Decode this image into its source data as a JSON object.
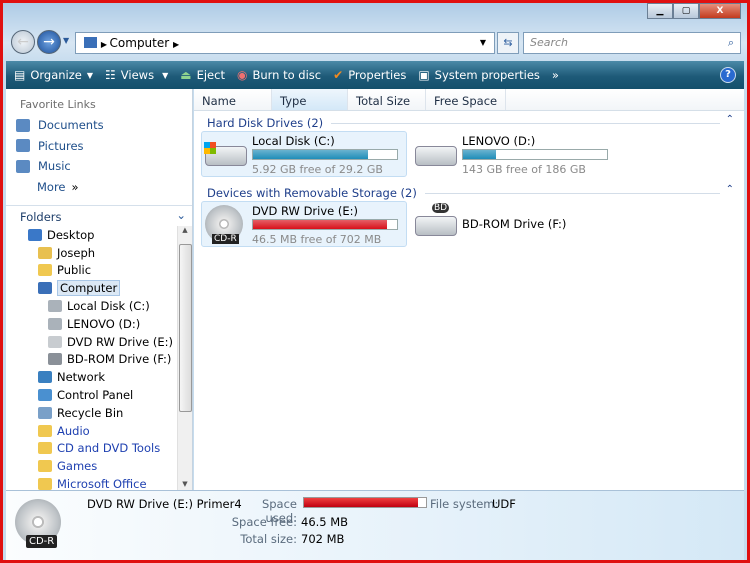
{
  "window": {
    "buttons": [
      "minimize",
      "maximize",
      "close"
    ]
  },
  "nav": {
    "address": [
      "Computer"
    ],
    "search_placeholder": "Search"
  },
  "toolbar": {
    "items": [
      {
        "label": "Organize",
        "icon": "organize-icon",
        "dropdown": true
      },
      {
        "label": "Views",
        "icon": "views-icon",
        "dropdown": true
      },
      {
        "label": "Eject",
        "icon": "eject-icon"
      },
      {
        "label": "Burn to disc",
        "icon": "burn-icon"
      },
      {
        "label": "Properties",
        "icon": "checkmark-icon"
      },
      {
        "label": "System properties",
        "icon": "system-properties-icon"
      }
    ],
    "more": "»",
    "help": "?"
  },
  "favorites": {
    "title": "Favorite Links",
    "items": [
      "Documents",
      "Pictures",
      "Music"
    ],
    "more": "More"
  },
  "folders": {
    "title": "Folders",
    "tree": [
      {
        "label": "Desktop",
        "level": 0,
        "icon": "desktop-icon"
      },
      {
        "label": "Joseph",
        "level": 1,
        "icon": "user-folder-icon"
      },
      {
        "label": "Public",
        "level": 1,
        "icon": "folder-icon"
      },
      {
        "label": "Computer",
        "level": 1,
        "icon": "computer-icon",
        "selected": true
      },
      {
        "label": "Local Disk (C:)",
        "level": 2,
        "icon": "hard-drive-icon"
      },
      {
        "label": "LENOVO (D:)",
        "level": 2,
        "icon": "hard-drive-icon"
      },
      {
        "label": "DVD RW Drive (E:) Primer4",
        "level": 2,
        "icon": "cd-icon"
      },
      {
        "label": "BD-ROM Drive (F:)",
        "level": 2,
        "icon": "bd-drive-icon"
      },
      {
        "label": "Network",
        "level": 1,
        "icon": "network-icon"
      },
      {
        "label": "Control Panel",
        "level": 1,
        "icon": "control-panel-icon"
      },
      {
        "label": "Recycle Bin",
        "level": 1,
        "icon": "recycle-bin-icon"
      },
      {
        "label": "Audio",
        "level": 1,
        "icon": "folder-icon",
        "link": true
      },
      {
        "label": "CD and DVD Tools",
        "level": 1,
        "icon": "folder-icon",
        "link": true
      },
      {
        "label": "Games",
        "level": 1,
        "icon": "folder-icon",
        "link": true
      },
      {
        "label": "Microsoft Office",
        "level": 1,
        "icon": "folder-icon",
        "link": true
      }
    ]
  },
  "columns": [
    "Name",
    "Type",
    "Total Size",
    "Free Space"
  ],
  "groups": [
    {
      "title": "Hard Disk Drives (2)",
      "drives": [
        {
          "name": "Local Disk (C:)",
          "sub": "5.92 GB free of 29.2 GB",
          "used_pct": 79.7,
          "color": "#1f8db8",
          "icon": "windows-hard-drive-icon",
          "highlight": true
        },
        {
          "name": "LENOVO (D:)",
          "sub": "143 GB free of 186 GB",
          "used_pct": 23.1,
          "color": "#1f8db8",
          "icon": "hard-drive-icon"
        }
      ]
    },
    {
      "title": "Devices with Removable Storage (2)",
      "drives": [
        {
          "name": "DVD RW Drive (E:) Primer4",
          "sub": "46.5 MB free of 702 MB",
          "used_pct": 93.4,
          "color": "#d8101a",
          "icon": "cd-r-icon",
          "badge": "CD-R",
          "highlight": true
        },
        {
          "name": "BD-ROM Drive (F:)",
          "icon": "bd-rom-drive-icon",
          "badge": "BD"
        }
      ]
    }
  ],
  "details": {
    "name": "DVD RW Drive (E:) Primer4",
    "badge": "CD-R",
    "space_used_label": "Space used:",
    "used_pct": 93.4,
    "fs_label": "File system:",
    "fs": "UDF",
    "free_label": "Space free:",
    "free": "46.5 MB",
    "total_label": "Total size:",
    "total": "702 MB"
  }
}
